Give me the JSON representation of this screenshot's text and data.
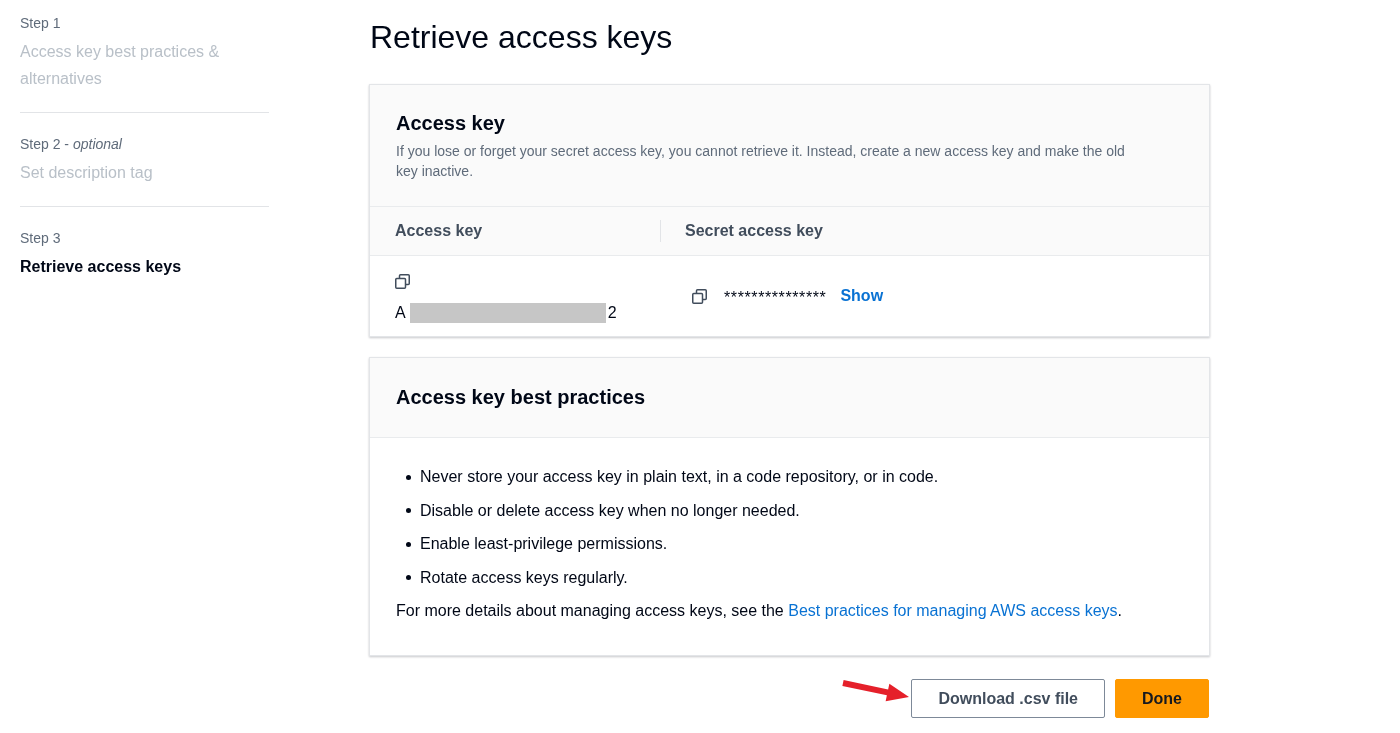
{
  "steps": [
    {
      "label": "Step 1",
      "title": "Access key best practices & alternatives",
      "selected": false
    },
    {
      "label": "Step 2 - *optional*",
      "title": "Set description tag",
      "selected": false
    },
    {
      "label": "Step 3",
      "title": "Retrieve access keys",
      "selected": true
    }
  ],
  "page_title": "Retrieve access keys",
  "access_key_panel": {
    "title": "Access key",
    "description": "If you lose or forget your secret access key, you cannot retrieve it. Instead, create a new access key and make the old key inactive.",
    "columns": [
      "Access key",
      "Secret access key"
    ],
    "access_key": {
      "visible_start": "A",
      "redacted": true,
      "visible_end": "2"
    },
    "secret_access_key": {
      "value": "***************",
      "show_link": "Show"
    }
  },
  "best_practices_panel": {
    "title": "Access key best practices",
    "items": [
      "Never store your access key in plain text, in a code repository, or in code.",
      "Disable or delete access key when no longer needed.",
      "Enable least-privilege permissions.",
      "Rotate access keys regularly."
    ],
    "footer": {
      "text": "For more details about managing access keys, see the ",
      "link": "Best practices for managing AWS access keys",
      "end": "."
    }
  },
  "buttons": [
    {
      "label": "Download .csv file",
      "kind": "secondary"
    },
    {
      "label": "Done",
      "kind": "primary"
    }
  ]
}
